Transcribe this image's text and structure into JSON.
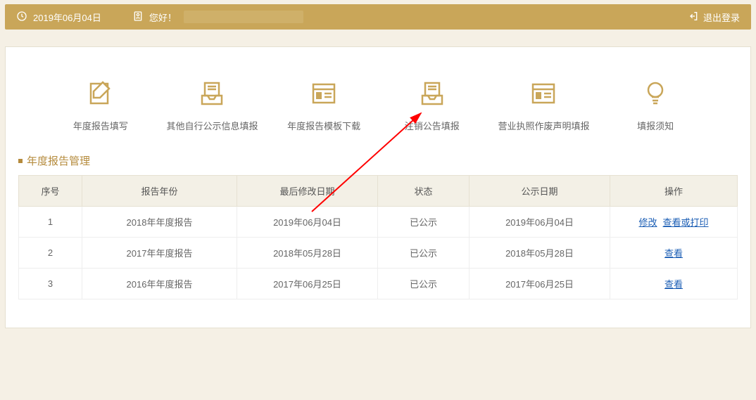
{
  "colors": {
    "primary": "#c9a659",
    "link": "#1a5db4"
  },
  "header": {
    "date": "2019年06月04日",
    "greeting": "您好！",
    "logout_label": "退出登录"
  },
  "menu": {
    "items": [
      {
        "label": "年度报告填写"
      },
      {
        "label": "其他自行公示信息填报"
      },
      {
        "label": "年度报告模板下载"
      },
      {
        "label": "注销公告填报"
      },
      {
        "label": "营业执照作废声明填报"
      },
      {
        "label": "填报须知"
      }
    ]
  },
  "section": {
    "title": "年度报告管理"
  },
  "table": {
    "headers": {
      "seq": "序号",
      "year": "报告年份",
      "last_modified": "最后修改日期",
      "status": "状态",
      "publish_date": "公示日期",
      "actions": "操作"
    },
    "rows": [
      {
        "seq": "1",
        "year": "2018年年度报告",
        "last_modified": "2019年06月04日",
        "status": "已公示",
        "publish_date": "2019年06月04日",
        "actions": [
          "修改",
          "查看或打印"
        ]
      },
      {
        "seq": "2",
        "year": "2017年年度报告",
        "last_modified": "2018年05月28日",
        "status": "已公示",
        "publish_date": "2018年05月28日",
        "actions": [
          "查看"
        ]
      },
      {
        "seq": "3",
        "year": "2016年年度报告",
        "last_modified": "2017年06月25日",
        "status": "已公示",
        "publish_date": "2017年06月25日",
        "actions": [
          "查看"
        ]
      }
    ]
  }
}
